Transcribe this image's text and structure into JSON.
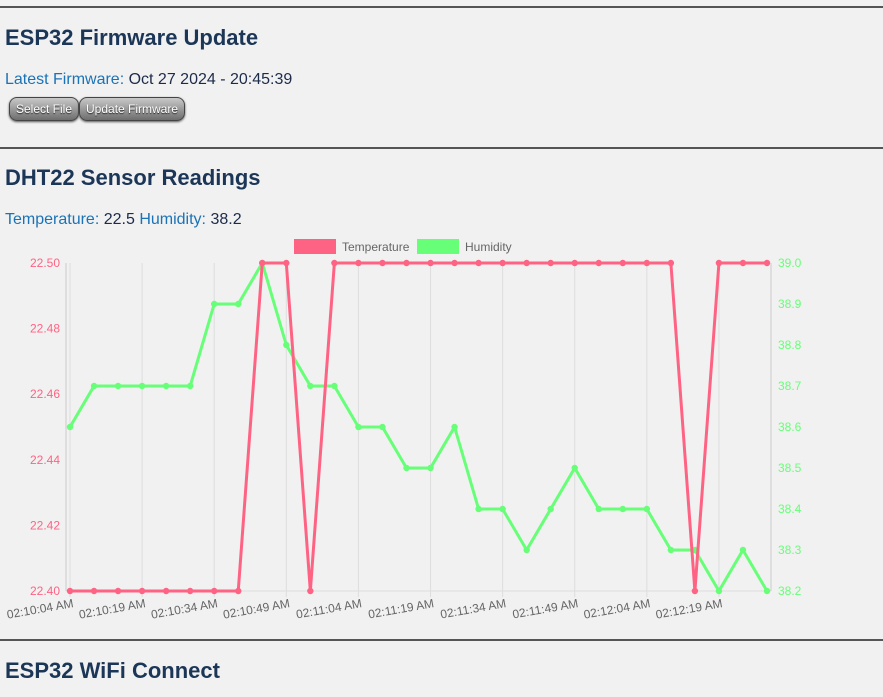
{
  "firmware": {
    "title": "ESP32 Firmware Update",
    "latest_label": "Latest Firmware:",
    "latest_value": "Oct 27 2024 - 20:45:39",
    "select_button": "Select File",
    "update_button": "Update Firmware"
  },
  "sensor": {
    "title": "DHT22 Sensor Readings",
    "temp_label": "Temperature:",
    "temp_value": "22.5",
    "humidity_label": "Humidity:",
    "humidity_value": "38.2"
  },
  "wifi": {
    "title": "ESP32 WiFi Connect"
  },
  "colors": {
    "temperature": "#ff6384",
    "humidity": "#66ff77"
  },
  "chart_data": {
    "type": "line",
    "x": [
      "02:10:04 AM",
      "02:10:09 AM",
      "02:10:14 AM",
      "02:10:19 AM",
      "02:10:24 AM",
      "02:10:29 AM",
      "02:10:34 AM",
      "02:10:39 AM",
      "02:10:44 AM",
      "02:10:49 AM",
      "02:10:54 AM",
      "02:10:59 AM",
      "02:11:04 AM",
      "02:11:09 AM",
      "02:11:14 AM",
      "02:11:19 AM",
      "02:11:24 AM",
      "02:11:29 AM",
      "02:11:34 AM",
      "02:11:39 AM",
      "02:11:44 AM",
      "02:11:49 AM",
      "02:11:54 AM",
      "02:11:59 AM",
      "02:12:04 AM",
      "02:12:09 AM",
      "02:12:14 AM",
      "02:12:19 AM",
      "02:12:24 AM",
      "02:12:29 AM"
    ],
    "x_tick_labels": [
      "02:10:04 AM",
      "02:10:19 AM",
      "02:10:34 AM",
      "02:10:49 AM",
      "02:11:04 AM",
      "02:11:19 AM",
      "02:11:34 AM",
      "02:11:49 AM",
      "02:12:04 AM",
      "02:12:19 AM"
    ],
    "series": [
      {
        "name": "Temperature",
        "axis": "left",
        "values": [
          22.4,
          22.4,
          22.4,
          22.4,
          22.4,
          22.4,
          22.4,
          22.4,
          22.5,
          22.5,
          22.4,
          22.5,
          22.5,
          22.5,
          22.5,
          22.5,
          22.5,
          22.5,
          22.5,
          22.5,
          22.5,
          22.5,
          22.5,
          22.5,
          22.5,
          22.5,
          22.4,
          22.5,
          22.5,
          22.5
        ]
      },
      {
        "name": "Humidity",
        "axis": "right",
        "values": [
          38.6,
          38.7,
          38.7,
          38.7,
          38.7,
          38.7,
          38.9,
          38.9,
          39.0,
          38.8,
          38.7,
          38.7,
          38.6,
          38.6,
          38.5,
          38.5,
          38.6,
          38.4,
          38.4,
          38.3,
          38.4,
          38.5,
          38.4,
          38.4,
          38.4,
          38.3,
          38.3,
          38.2,
          38.3,
          38.2
        ]
      }
    ],
    "y_left": {
      "ylim": [
        22.4,
        22.5
      ],
      "ticks": [
        "22.40",
        "22.42",
        "22.44",
        "22.46",
        "22.48",
        "22.50"
      ]
    },
    "y_right": {
      "ylim": [
        38.2,
        39.0
      ],
      "ticks": [
        "38.2",
        "38.3",
        "38.4",
        "38.5",
        "38.6",
        "38.7",
        "38.8",
        "38.9",
        "39.0"
      ]
    },
    "legend_position": "top",
    "grid": "vertical"
  }
}
